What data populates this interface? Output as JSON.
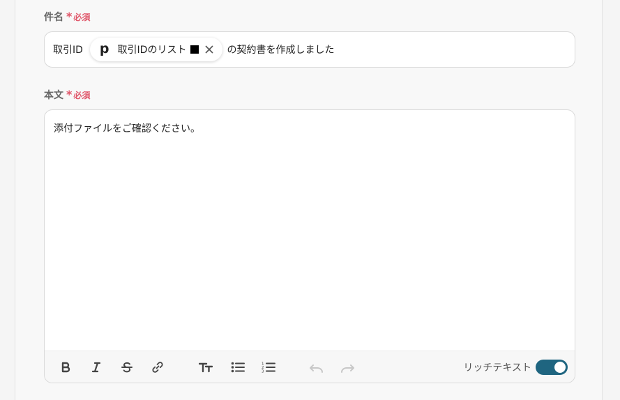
{
  "subject": {
    "label": "件名",
    "required": "必須",
    "prefix": "取引ID",
    "chip": {
      "logo": "p",
      "text": "取引IDのリスト"
    },
    "suffix": "の契約書を作成しました"
  },
  "body": {
    "label": "本文",
    "required": "必須",
    "text": "添付ファイルをご確認ください。"
  },
  "toolbar": {
    "buttons": [
      "bold",
      "italic",
      "strikethrough",
      "link",
      "text-size",
      "bullet-list",
      "numbered-list",
      "undo",
      "redo"
    ],
    "rich_text_label": "リッチテキスト",
    "rich_text_enabled": true
  },
  "colors": {
    "required": "#e0586b",
    "toggle": "#1f6580"
  }
}
